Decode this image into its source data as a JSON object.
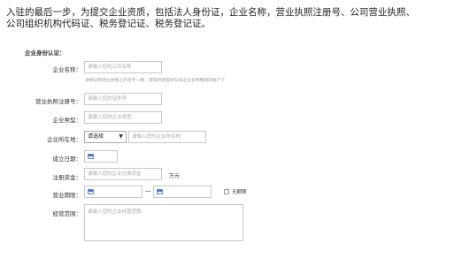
{
  "intro": {
    "line1": "入驻的最后一步，为提交企业资质，包括法人身份证，企业名称，营业执照注册号、公司营业执照、",
    "line2": "公司组织机构代码证、税务登记证、税务登记证。"
  },
  "form": {
    "section_title": "企业身份认证：",
    "company_name": {
      "label": "企业名称：",
      "placeholder": "请输入您的公司名称",
      "hint": "请保证和营业执照上的名字一致，提现时将提到与该企业名称相同的账户下"
    },
    "license_no": {
      "label": "营业执照注册号：",
      "placeholder": "请输入您的证件号"
    },
    "company_type": {
      "label": "企业类型：",
      "placeholder": "请输入您的企业类型"
    },
    "location": {
      "label": "企业所在地：",
      "select_value": "请选择",
      "placeholder": "请输入您的企业所在地"
    },
    "established": {
      "label": "成立日期："
    },
    "capital": {
      "label": "注册资金：",
      "placeholder": "请输入您的企业注册资金",
      "unit": "万元"
    },
    "term": {
      "label": "营业期限：",
      "separator": "—",
      "checkbox_label": "无期限",
      "checked": false
    },
    "scope": {
      "label": "经营范围：",
      "placeholder": "请输入您的企业经营范围"
    }
  },
  "icons": {
    "calendar": "calendar-icon",
    "chevron": "chevron-down-icon"
  }
}
